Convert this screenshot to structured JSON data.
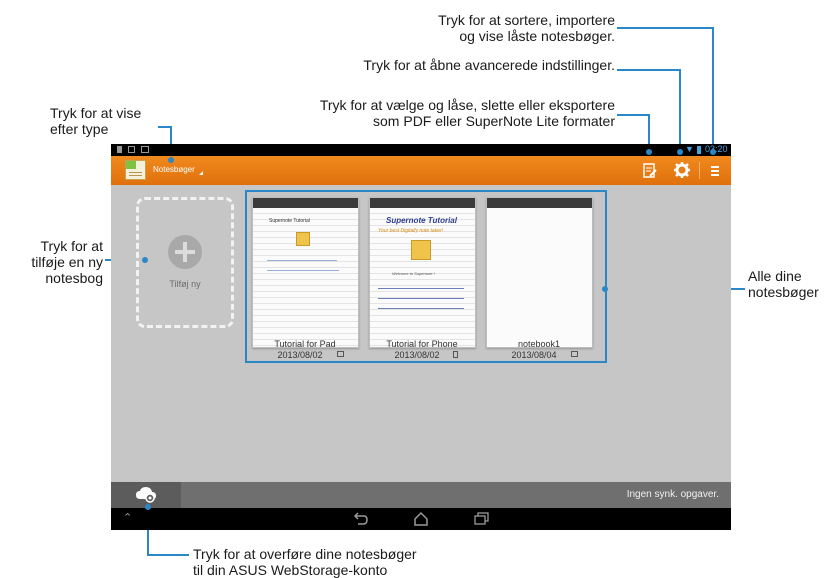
{
  "callouts": {
    "sort": "Tryk for at sortere, importere\nog vise låste notesbøger.",
    "settings": "Tryk for at åbne avancerede indstillinger.",
    "lock": "Tryk for at vælge og låse, slette eller eksportere\nsom PDF eller SuperNote Lite formater",
    "view": "Tryk for at vise\nefter type",
    "add": "Tryk for at\ntilføje en ny\nnotesbog",
    "all": "Alle dine\nnotesbøger",
    "upload": "Tryk for at overføre dine notesbøger\ntil din ASUS WebStorage-konto"
  },
  "status_bar": {
    "time": "03:20"
  },
  "action_bar": {
    "dropdown_label": "Notesbøger"
  },
  "add_tile": {
    "label": "Tilføj ny"
  },
  "notebooks": [
    {
      "name": "Tutorial for Pad",
      "date": "2013/08/02",
      "title": "Supernote Tutorial"
    },
    {
      "name": "Tutorial for Phone",
      "date": "2013/08/02",
      "title": "Supernote Tutorial",
      "subtitle": "Your best Digitally note taker!",
      "welcome": "Welcome to Supernote !"
    },
    {
      "name": "notebook1",
      "date": "2013/08/04"
    }
  ],
  "bottom_bar": {
    "sync_status": "Ingen synk. opgaver."
  },
  "colors": {
    "accent": "#e87a14",
    "callout_line": "#2b88c8"
  }
}
